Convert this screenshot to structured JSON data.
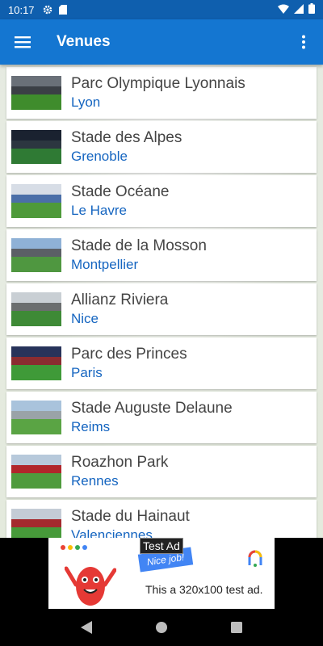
{
  "status_bar": {
    "time": "10:17",
    "icons": [
      "gear-icon",
      "sd-card-icon",
      "wifi-icon",
      "signal-icon",
      "battery-icon"
    ]
  },
  "app_bar": {
    "title": "Venues",
    "menu_icon": "hamburger-menu-icon",
    "overflow_icon": "more-vert-icon",
    "color": "#1476d1"
  },
  "venues": [
    {
      "name": "Parc Olympique Lyonnais",
      "city": "Lyon"
    },
    {
      "name": "Stade des Alpes",
      "city": "Grenoble"
    },
    {
      "name": "Stade Océane",
      "city": "Le Havre"
    },
    {
      "name": "Stade de la Mosson",
      "city": "Montpellier"
    },
    {
      "name": "Allianz Riviera",
      "city": "Nice"
    },
    {
      "name": "Parc des Princes",
      "city": "Paris"
    },
    {
      "name": "Stade Auguste Delaune",
      "city": "Reims"
    },
    {
      "name": "Roazhon Park",
      "city": "Rennes"
    },
    {
      "name": "Stade du Hainaut",
      "city": "Valenciennes"
    }
  ],
  "ad": {
    "label": "Test Ad",
    "badge": "Nice job!",
    "text": "This a 320x100 test ad."
  },
  "nav_bar": {
    "back_icon": "back-triangle-icon",
    "home_icon": "home-circle-icon",
    "recents_icon": "recents-square-icon"
  },
  "colors": {
    "accent": "#1476d1",
    "status_bar": "#0f5fae",
    "city_text": "#1565c0"
  }
}
